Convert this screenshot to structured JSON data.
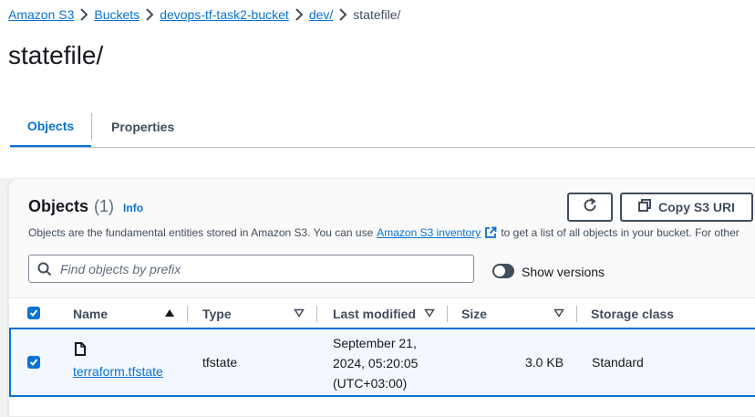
{
  "breadcrumb": {
    "items": [
      "Amazon S3",
      "Buckets",
      "devops-tf-task2-bucket",
      "dev/"
    ],
    "current": "statefile/"
  },
  "page": {
    "title": "statefile/"
  },
  "tabs": {
    "objects": "Objects",
    "properties": "Properties"
  },
  "objects_panel": {
    "title": "Objects",
    "count": "(1)",
    "info": "Info",
    "copy_uri_label": "Copy S3 URI",
    "description_prefix": "Objects are the fundamental entities stored in Amazon S3. You can use",
    "inventory_link": "Amazon S3 inventory",
    "description_suffix": "to get a list of all objects in your bucket. For other",
    "search_placeholder": "Find objects by prefix",
    "show_versions_label": "Show versions",
    "show_versions_enabled": false
  },
  "table": {
    "columns": [
      "Name",
      "Type",
      "Last modified",
      "Size",
      "Storage class"
    ],
    "rows": [
      {
        "selected": true,
        "name": "terraform.tfstate",
        "type": "tfstate",
        "last_modified_line1": "September 21,",
        "last_modified_line2": "2024, 05:20:05",
        "last_modified_line3": "(UTC+03:00)",
        "size": "3.0 KB",
        "storage_class": "Standard"
      }
    ]
  },
  "icons": [
    "chevron-right-icon",
    "refresh-icon",
    "copy-icon",
    "external-link-icon",
    "search-icon",
    "checkbox-checked-icon",
    "sort-ascending-icon",
    "sort-icon",
    "file-icon"
  ],
  "colors": {
    "link": "#0972d3",
    "text": "#16191f",
    "secondary": "#414d5c",
    "selected_row": "#f2f8fd"
  }
}
